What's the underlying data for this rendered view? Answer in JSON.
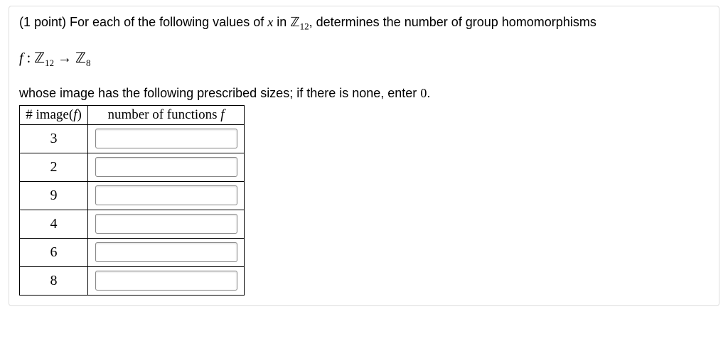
{
  "problem": {
    "points_prefix": "(1 point) ",
    "line1_a": "For each of the following values of ",
    "line1_var": "x",
    "line1_b": " in ",
    "line1_set": "ℤ",
    "line1_sub": "12",
    "line1_c": ", determines the number of group homomorphisms",
    "map_f": "f",
    "map_colon": " : ",
    "map_dom": "ℤ",
    "map_dom_sub": "12",
    "map_arrow": " → ",
    "map_cod": "ℤ",
    "map_cod_sub": "8",
    "line3_a": "whose image has the following prescribed sizes; if there is none, enter ",
    "line3_zero": "0",
    "line3_b": "."
  },
  "table": {
    "header_col1_a": "# image(",
    "header_col1_f": "f",
    "header_col1_b": ")",
    "header_col2_a": "number of functions ",
    "header_col2_f": "f",
    "rows": [
      {
        "size": "3",
        "answer": ""
      },
      {
        "size": "2",
        "answer": ""
      },
      {
        "size": "9",
        "answer": ""
      },
      {
        "size": "4",
        "answer": ""
      },
      {
        "size": "6",
        "answer": ""
      },
      {
        "size": "8",
        "answer": ""
      }
    ]
  }
}
